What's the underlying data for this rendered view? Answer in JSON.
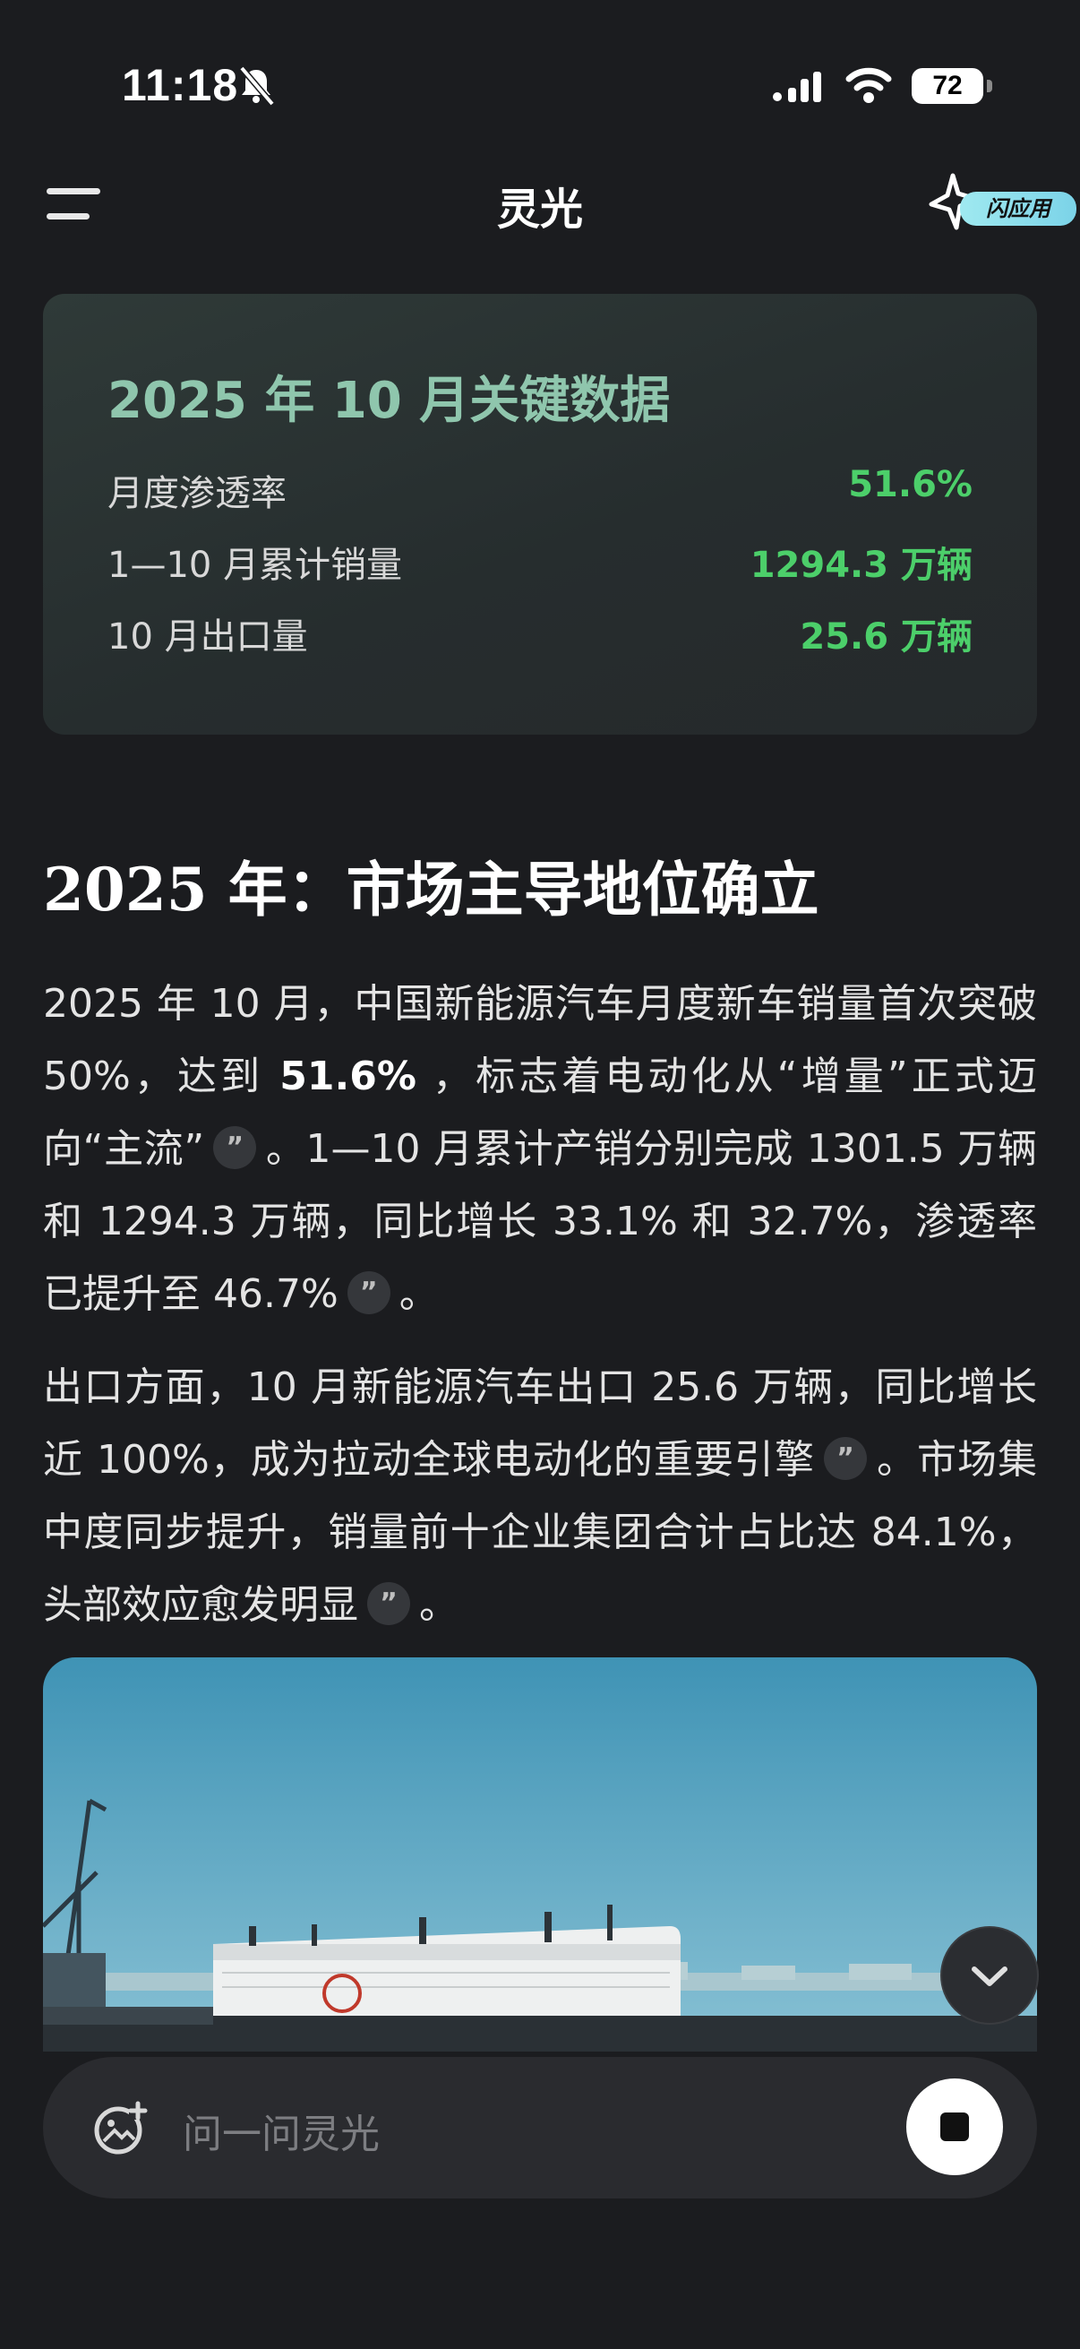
{
  "status_bar": {
    "time": "11:18",
    "battery": "72"
  },
  "nav": {
    "title": "灵光",
    "flash_app_label": "闪应用"
  },
  "key_data_card": {
    "title": "2025 年 10 月关键数据",
    "rows": [
      {
        "label": "月度渗透率",
        "value": "51.6%"
      },
      {
        "label": "1—10 月累计销量",
        "value": "1294.3 万辆"
      },
      {
        "label": "10 月出口量",
        "value": "25.6 万辆"
      }
    ]
  },
  "article": {
    "heading": "2025 年：市场主导地位确立",
    "p1": {
      "a": "2025 年 10 月，中国新能源汽车月度新车销量首次突破 50%，达到 ",
      "bold": "51.6%",
      "b": " ，标志着电动化从“增量”正式迈向“主流”",
      "c": "。1—10 月累计产销分别完成 1301.5 万辆和 1294.3 万辆，同比增长 33.1% 和 32.7%，渗透率已提升至 46.7%",
      "d": "。"
    },
    "p2": {
      "a": "出口方面，10 月新能源汽车出口 25.6 万辆，同比增长近 100%，成为拉动全球电动化的重要引擎",
      "b": "。市场集中度同步提升，销量前十企业集团合计占比达 84.1%，头部效应愈发明显",
      "c": "。"
    },
    "citation_glyph": "”"
  },
  "input": {
    "placeholder": "问一问灵光"
  },
  "colors": {
    "accent_green": "#4ccf6a",
    "card_title": "#8fc6ad",
    "background": "#1b1c1f"
  },
  "icons": [
    "bell-slash-icon",
    "cellular-signal-icon",
    "wifi-icon",
    "menu-icon",
    "flash-star-icon",
    "citation-icon",
    "chevron-down-icon",
    "image-add-icon",
    "stop-icon"
  ]
}
